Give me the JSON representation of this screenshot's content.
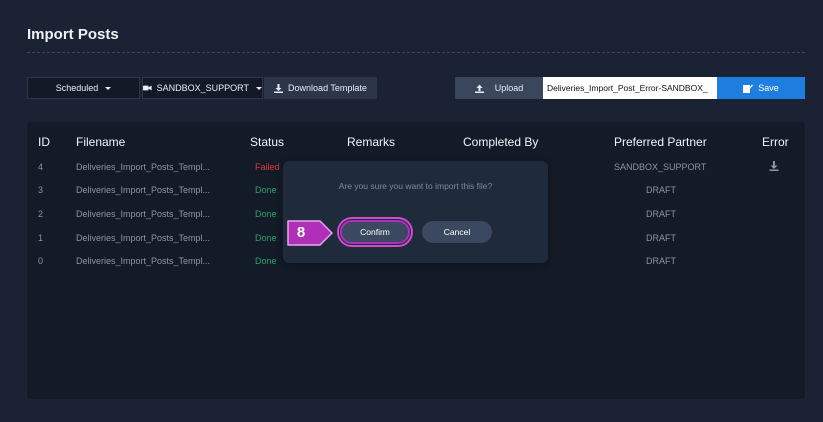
{
  "header": {
    "title": "Import Posts"
  },
  "toolbar": {
    "scheduled_label": "Scheduled",
    "partner_label": "SANDBOX_SUPPORT",
    "download_label": "Download Template",
    "upload_label": "Upload",
    "file_name": "Deliveries_Import_Post_Error-SANDBOX_",
    "save_label": "Save"
  },
  "table": {
    "columns": [
      "ID",
      "Filename",
      "Status",
      "Remarks",
      "Completed By",
      "Preferred Partner",
      "Error"
    ],
    "rows": [
      {
        "id": "4",
        "filename": "Deliveries_Import_Posts_Templ...",
        "status": "Failed",
        "partner": "SANDBOX_SUPPORT"
      },
      {
        "id": "3",
        "filename": "Deliveries_Import_Posts_Templ...",
        "status": "Done",
        "partner": "DRAFT"
      },
      {
        "id": "2",
        "filename": "Deliveries_Import_Posts_Templ...",
        "status": "Done",
        "partner": "DRAFT"
      },
      {
        "id": "1",
        "filename": "Deliveries_Import_Posts_Templ...",
        "status": "Done",
        "partner": "DRAFT"
      },
      {
        "id": "0",
        "filename": "Deliveries_Import_Posts_Templ...",
        "status": "Done",
        "partner": "DRAFT"
      }
    ]
  },
  "dialog": {
    "message": "Are you sure you want to import this file?",
    "confirm_label": "Confirm",
    "cancel_label": "Cancel"
  },
  "callout": {
    "step": "8",
    "color": "#b02fb8"
  },
  "colors": {
    "failed": "#e53935",
    "done": "#23a36b",
    "save": "#1e7ee0"
  },
  "icons": [
    "caret-down-icon",
    "camera-icon",
    "download-icon",
    "upload-icon",
    "save-icon"
  ]
}
